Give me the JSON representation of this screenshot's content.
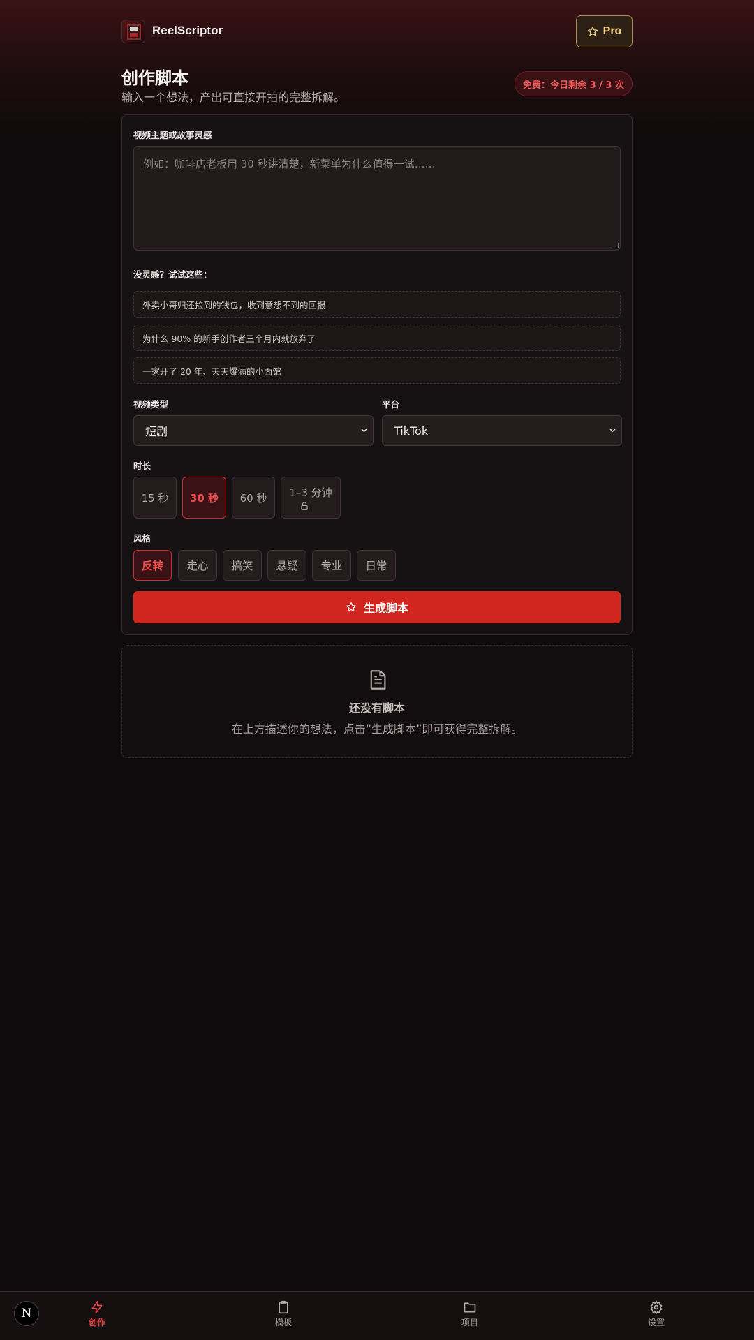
{
  "app": {
    "brand": "ReelScriptor",
    "pro_label": "Pro"
  },
  "page": {
    "title": "创作脚本",
    "subtitle": "输入一个想法，产出可直接开拍的完整拆解。",
    "quota": "免费：今日剩余 3 / 3 次"
  },
  "form": {
    "topic_label": "视频主题或故事灵感",
    "topic_placeholder": "例如：咖啡店老板用 30 秒讲清楚，新菜单为什么值得一试……",
    "inspiration_label": "没灵感？试试这些：",
    "ideas": [
      "外卖小哥归还捡到的钱包，收到意想不到的回报",
      "为什么 90% 的新手创作者三个月内就放弃了",
      "一家开了 20 年、天天爆满的小面馆"
    ],
    "type_label": "视频类型",
    "type_value": "短剧",
    "platform_label": "平台",
    "platform_value": "TikTok",
    "duration_label": "时长",
    "durations": [
      "15 秒",
      "30 秒",
      "60 秒",
      "1–3 分钟"
    ],
    "duration_selected": "30 秒",
    "style_label": "风格",
    "styles": [
      "反转",
      "走心",
      "搞笑",
      "悬疑",
      "专业",
      "日常"
    ],
    "style_selected": "反转",
    "generate_label": "生成脚本"
  },
  "empty": {
    "title": "还没有脚本",
    "desc": "在上方描述你的想法，点击“生成脚本”即可获得完整拆解。"
  },
  "nav": {
    "badge": "N",
    "items": [
      {
        "label": "创作",
        "icon": "lightning-icon",
        "active": true
      },
      {
        "label": "模板",
        "icon": "clipboard-icon",
        "active": false
      },
      {
        "label": "项目",
        "icon": "folder-icon",
        "active": false
      },
      {
        "label": "设置",
        "icon": "gear-icon",
        "active": false
      }
    ]
  },
  "colors": {
    "accent": "#d12620",
    "pro_gold": "#f0d28a",
    "background": "#0f0b0c"
  }
}
